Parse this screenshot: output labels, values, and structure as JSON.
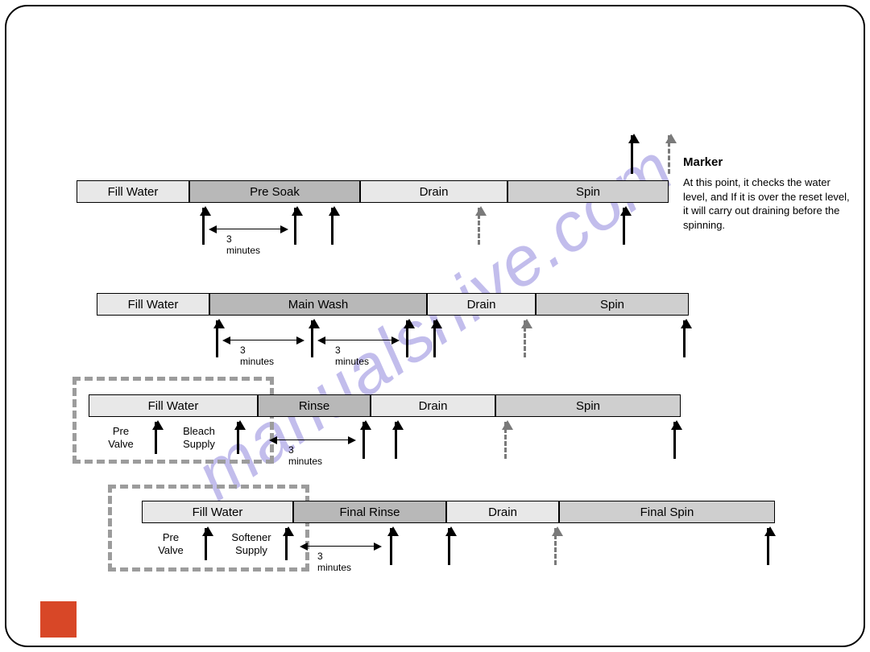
{
  "marker": {
    "title": "Marker",
    "text": "At this point, it checks the water level, and If it is over the reset level, it will carry out draining before the spinning."
  },
  "labels": {
    "min3": "3 minutes",
    "pre_valve": "Pre\nValve",
    "bleach": "Bleach\nSupply",
    "softener": "Softener\nSupply"
  },
  "rows": [
    {
      "id": "r1",
      "segs": [
        "Fill Water",
        "Pre Soak",
        "Drain",
        "Spin"
      ]
    },
    {
      "id": "r2",
      "segs": [
        "Fill Water",
        "Main Wash",
        "Drain",
        "Spin"
      ]
    },
    {
      "id": "r3",
      "segs": [
        "Fill Water",
        "Rinse",
        "Drain",
        "Spin"
      ]
    },
    {
      "id": "r4",
      "segs": [
        "Fill Water",
        "Final Rinse",
        "Drain",
        "Final Spin"
      ]
    }
  ]
}
